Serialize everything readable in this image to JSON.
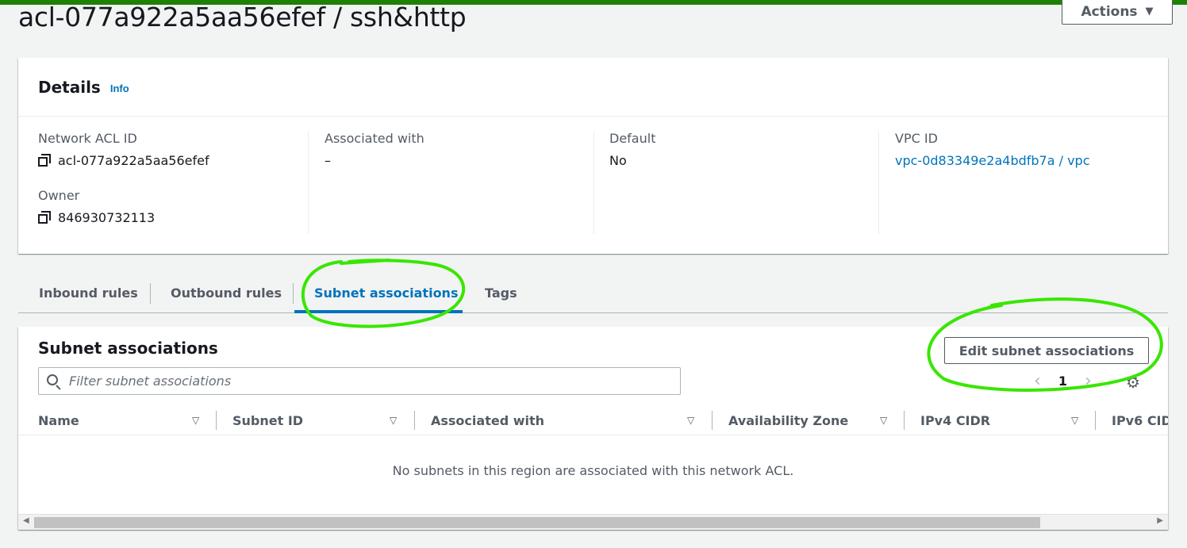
{
  "header": {
    "title": "acl-077a922a5aa56efef / ssh&http",
    "actions_label": "Actions"
  },
  "details": {
    "title": "Details",
    "info_label": "Info",
    "network_acl_id_label": "Network ACL ID",
    "network_acl_id": "acl-077a922a5aa56efef",
    "owner_label": "Owner",
    "owner": "846930732113",
    "associated_with_label": "Associated with",
    "associated_with": "–",
    "default_label": "Default",
    "default": "No",
    "vpc_id_label": "VPC ID",
    "vpc_id": "vpc-0d83349e2a4bdfb7a / vpc"
  },
  "tabs": [
    {
      "label": "Inbound rules"
    },
    {
      "label": "Outbound rules"
    },
    {
      "label": "Subnet associations"
    },
    {
      "label": "Tags"
    }
  ],
  "subnet_panel": {
    "title": "Subnet associations",
    "edit_label": "Edit subnet associations",
    "filter_placeholder": "Filter subnet associations",
    "page": "1",
    "columns": [
      "Name",
      "Subnet ID",
      "Associated with",
      "Availability Zone",
      "IPv4 CIDR",
      "IPv6 CIDR"
    ],
    "empty_message": "No subnets in this region are associated with this network ACL."
  },
  "colors": {
    "accent": "#0073bb",
    "top_bar": "#1d8102",
    "annotation": "#39e600"
  }
}
